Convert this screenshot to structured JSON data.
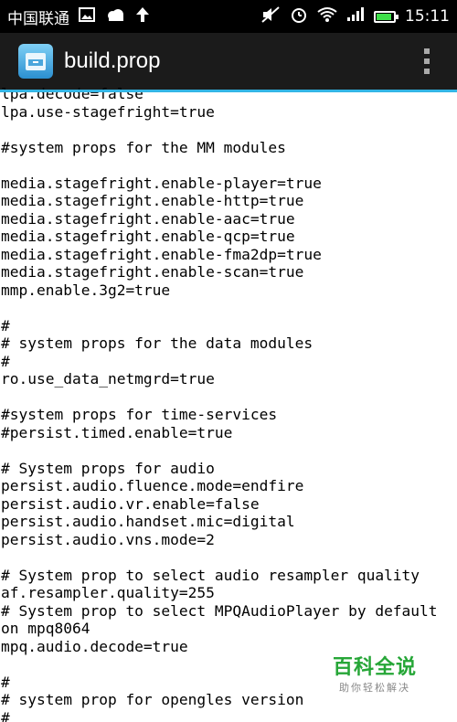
{
  "status_bar": {
    "carrier": "中国联通",
    "time": "15:11"
  },
  "action_bar": {
    "title": "build.prop"
  },
  "content_lines": [
    "lpa.decode=false",
    "lpa.use-stagefright=true",
    "",
    "#system props for the MM modules",
    "",
    "media.stagefright.enable-player=true",
    "media.stagefright.enable-http=true",
    "media.stagefright.enable-aac=true",
    "media.stagefright.enable-qcp=true",
    "media.stagefright.enable-fma2dp=true",
    "media.stagefright.enable-scan=true",
    "mmp.enable.3g2=true",
    "",
    "#",
    "# system props for the data modules",
    "#",
    "ro.use_data_netmgrd=true",
    "",
    "#system props for time-services",
    "#persist.timed.enable=true",
    "",
    "# System props for audio",
    "persist.audio.fluence.mode=endfire",
    "persist.audio.vr.enable=false",
    "persist.audio.handset.mic=digital",
    "persist.audio.vns.mode=2",
    "",
    "# System prop to select audio resampler quality",
    "af.resampler.quality=255",
    "# System prop to select MPQAudioPlayer by default",
    "on mpq8064",
    "mpq.audio.decode=true",
    "",
    "#",
    "# system prop for opengles version",
    "#"
  ],
  "watermark": {
    "title": "百科全说",
    "subtitle": "助你轻松解决"
  }
}
